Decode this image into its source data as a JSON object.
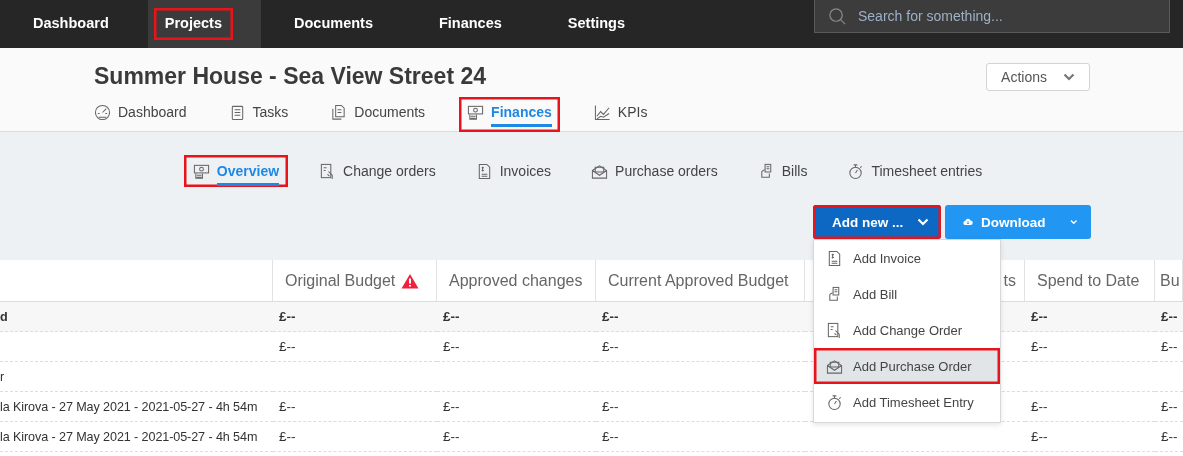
{
  "top_nav": {
    "items": [
      {
        "label": "Dashboard",
        "selected": false,
        "highlighted": false
      },
      {
        "label": "Projects",
        "selected": true,
        "highlighted": true
      },
      {
        "label": "Documents",
        "selected": false,
        "highlighted": false
      },
      {
        "label": "Finances",
        "selected": false,
        "highlighted": false
      },
      {
        "label": "Settings",
        "selected": false,
        "highlighted": false
      }
    ],
    "search": {
      "placeholder": "Search for something..."
    }
  },
  "project": {
    "title": "Summer House - Sea View Street 24",
    "actions_button": "Actions"
  },
  "tabs": [
    {
      "label": "Dashboard",
      "selected": false,
      "highlighted": false
    },
    {
      "label": "Tasks",
      "selected": false,
      "highlighted": false
    },
    {
      "label": "Documents",
      "selected": false,
      "highlighted": false
    },
    {
      "label": "Finances",
      "selected": true,
      "highlighted": true
    },
    {
      "label": "KPIs",
      "selected": false,
      "highlighted": false
    }
  ],
  "subtabs": [
    {
      "label": "Overview",
      "selected": true,
      "highlighted": true
    },
    {
      "label": "Change orders",
      "selected": false,
      "highlighted": false
    },
    {
      "label": "Invoices",
      "selected": false,
      "highlighted": false
    },
    {
      "label": "Purchase orders",
      "selected": false,
      "highlighted": false
    },
    {
      "label": "Bills",
      "selected": false,
      "highlighted": false
    },
    {
      "label": "Timesheet entries",
      "selected": false,
      "highlighted": false
    }
  ],
  "toolbar": {
    "add_button": {
      "label": "Add new ...",
      "highlighted": true
    },
    "download_button": {
      "label": "Download"
    }
  },
  "add_menu": {
    "items": [
      {
        "label": "Add Invoice",
        "selected": false,
        "highlighted": false
      },
      {
        "label": "Add Bill",
        "selected": false,
        "highlighted": false
      },
      {
        "label": "Add Change Order",
        "selected": false,
        "highlighted": false
      },
      {
        "label": "Add Purchase Order",
        "selected": true,
        "highlighted": true
      },
      {
        "label": "Add Timesheet Entry",
        "selected": false,
        "highlighted": false
      }
    ]
  },
  "table": {
    "columns": [
      {
        "warning": false
      },
      {
        "label": "Original Budget",
        "warning": true
      },
      {
        "label": "Approved changes",
        "warning": false
      },
      {
        "label": "Current Approved Budget",
        "warning": false
      },
      {
        "label": "ts",
        "warning": false
      },
      {
        "label": "Spend to Date",
        "warning": false
      },
      {
        "label": "Bu",
        "warning": false
      }
    ],
    "rows": [
      {
        "kind": "total",
        "cells": [
          "d",
          "£--",
          "£--",
          "£--",
          null,
          "£--",
          "£--"
        ]
      },
      {
        "kind": "item",
        "cells": [
          null,
          "£--",
          "£--",
          "£--",
          null,
          "£--",
          "£--"
        ]
      },
      {
        "kind": "group",
        "cells": [
          "r",
          null,
          null,
          null,
          null,
          null,
          null
        ]
      },
      {
        "kind": "item",
        "cells": [
          "la Kirova - 27 May 2021 - 2021-05-27 - 4h 54m",
          "£--",
          "£--",
          "£--",
          null,
          "£--",
          "£--"
        ]
      },
      {
        "kind": "item",
        "cells": [
          "la Kirova - 27 May 2021 - 2021-05-27 - 4h 54m",
          "£--",
          "£--",
          "£--",
          null,
          "£--",
          "£--"
        ]
      }
    ]
  }
}
